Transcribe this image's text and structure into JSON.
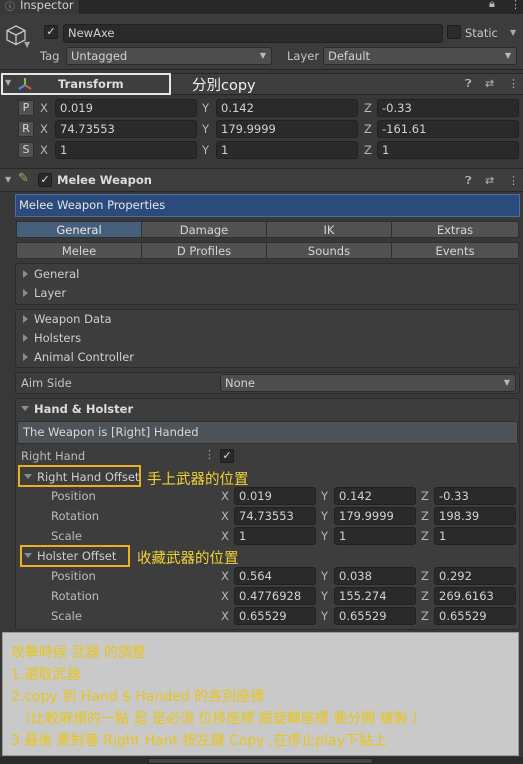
{
  "tab": {
    "title": "Inspector"
  },
  "object": {
    "name": "NewAxe",
    "static_label": "Static",
    "tag_label": "Tag",
    "tag_value": "Untagged",
    "layer_label": "Layer",
    "layer_value": "Default"
  },
  "transform": {
    "title": "Transform",
    "note": "分別copy",
    "rows": [
      {
        "btn": "P",
        "x": "0.019",
        "y": "0.142",
        "z": "-0.33"
      },
      {
        "btn": "R",
        "x": "74.73553",
        "y": "179.9999",
        "z": "-161.61"
      },
      {
        "btn": "S",
        "x": "1",
        "y": "1",
        "z": "1"
      }
    ],
    "axis": {
      "x": "X",
      "y": "Y",
      "z": "Z"
    }
  },
  "melee": {
    "title": "Melee Weapon",
    "properties_header": "Melee Weapon Properties",
    "tabs_row1": [
      "General",
      "Damage",
      "IK",
      "Extras"
    ],
    "tabs_row2": [
      "Melee",
      "D Profiles",
      "Sounds",
      "Events"
    ],
    "foldouts1": [
      "General",
      "Layer"
    ],
    "foldouts2": [
      "Weapon Data",
      "Holsters",
      "Animal Controller"
    ],
    "aim_side_label": "Aim Side",
    "aim_side_value": "None",
    "hand_holster_title": "Hand & Holster",
    "handed_message": "The Weapon is [Right] Handed",
    "right_hand_label": "Right Hand",
    "right_hand_offset": {
      "label": "Right Hand Offset",
      "note": "手上武器的位置",
      "position": {
        "label": "Position",
        "x": "0.019",
        "y": "0.142",
        "z": "-0.33"
      },
      "rotation": {
        "label": "Rotation",
        "x": "74.73553",
        "y": "179.9999",
        "z": "198.39"
      },
      "scale": {
        "label": "Scale",
        "x": "1",
        "y": "1",
        "z": "1"
      }
    },
    "holster_offset": {
      "label": "Holster Offset",
      "note": "收藏武器的位置",
      "position": {
        "label": "Position",
        "x": "0.564",
        "y": "0.038",
        "z": "0.292"
      },
      "rotation": {
        "label": "Rotation",
        "x": "0.4776928",
        "y": "155.274",
        "z": "269.6163"
      },
      "scale": {
        "label": "Scale",
        "x": "0.65529",
        "y": "0.65529",
        "z": "0.65529"
      }
    }
  },
  "instructions": {
    "line1": "攻擊時候 武器 的調整",
    "line2": "1.選取武器",
    "line3": "2.copy 到 Hand $ Handed 的各別座標",
    "line4": "（比較麻煩的一點 是 是必須 位移座標 跟旋轉座標 要分開 複製 ）",
    "line5": "3.最後 要對著 Right Hant 按左鍵 Copy ,在停止play下貼上"
  },
  "colors": {
    "accent_header": "#2c4b7d",
    "selected_tab": "#46607c",
    "annotation": "#f2d235",
    "box_orange": "#e8b01e"
  }
}
